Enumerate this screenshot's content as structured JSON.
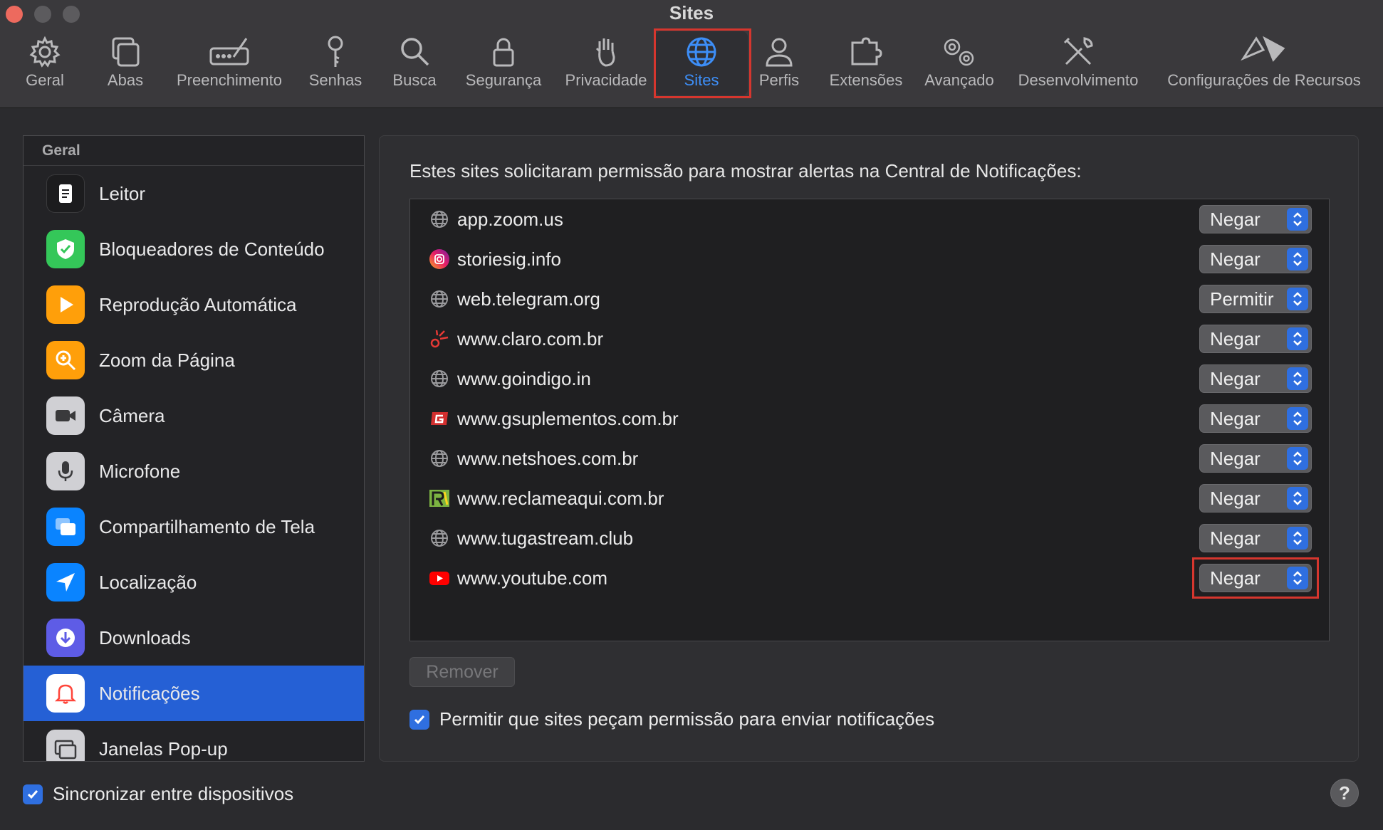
{
  "window": {
    "title": "Sites"
  },
  "toolbar": {
    "tabs": [
      {
        "label": "Geral",
        "icon": "gear-icon"
      },
      {
        "label": "Abas",
        "icon": "tabs-icon"
      },
      {
        "label": "Preenchimento",
        "icon": "autofill-icon"
      },
      {
        "label": "Senhas",
        "icon": "key-icon"
      },
      {
        "label": "Busca",
        "icon": "search-icon"
      },
      {
        "label": "Segurança",
        "icon": "lock-icon"
      },
      {
        "label": "Privacidade",
        "icon": "hand-icon"
      },
      {
        "label": "Sites",
        "icon": "globe-icon",
        "active": true
      },
      {
        "label": "Perfis",
        "icon": "person-icon"
      },
      {
        "label": "Extensões",
        "icon": "puzzle-icon"
      },
      {
        "label": "Avançado",
        "icon": "gears-icon"
      },
      {
        "label": "Desenvolvimento",
        "icon": "tools-icon"
      },
      {
        "label": "Configurações de Recursos",
        "icon": "flags-icon"
      }
    ]
  },
  "sidebar": {
    "header": "Geral",
    "items": [
      {
        "label": "Leitor",
        "icon": "reader-icon",
        "color": "#1c1c1e"
      },
      {
        "label": "Bloqueadores de Conteúdo",
        "icon": "shield-check-icon",
        "color": "#34c759"
      },
      {
        "label": "Reprodução Automática",
        "icon": "play-icon",
        "color": "#ff9f0a"
      },
      {
        "label": "Zoom da Página",
        "icon": "zoom-icon",
        "color": "#ff9f0a"
      },
      {
        "label": "Câmera",
        "icon": "camera-icon",
        "color": "#8e8e93"
      },
      {
        "label": "Microfone",
        "icon": "microphone-icon",
        "color": "#8e8e93"
      },
      {
        "label": "Compartilhamento de Tela",
        "icon": "screen-share-icon",
        "color": "#0a84ff"
      },
      {
        "label": "Localização",
        "icon": "location-icon",
        "color": "#0a84ff"
      },
      {
        "label": "Downloads",
        "icon": "download-icon",
        "color": "#5e5ce6"
      },
      {
        "label": "Notificações",
        "icon": "bell-icon",
        "color": "#ff453a",
        "selected": true
      },
      {
        "label": "Janelas Pop-up",
        "icon": "popup-window-icon",
        "color": "#8e8e93"
      }
    ]
  },
  "main": {
    "description": "Estes sites solicitaram permissão para mostrar alertas na Central de Notificações:",
    "sites": [
      {
        "name": "app.zoom.us",
        "favicon": "globe-icon",
        "permission": "Negar"
      },
      {
        "name": "storiesig.info",
        "favicon": "storiesig-icon",
        "permission": "Negar"
      },
      {
        "name": "web.telegram.org",
        "favicon": "globe-icon",
        "permission": "Permitir"
      },
      {
        "name": "www.claro.com.br",
        "favicon": "claro-icon",
        "permission": "Negar"
      },
      {
        "name": "www.goindigo.in",
        "favicon": "globe-icon",
        "permission": "Negar"
      },
      {
        "name": "www.gsuplementos.com.br",
        "favicon": "gsuplementos-icon",
        "permission": "Negar"
      },
      {
        "name": "www.netshoes.com.br",
        "favicon": "globe-icon",
        "permission": "Negar"
      },
      {
        "name": "www.reclameaqui.com.br",
        "favicon": "reclameaqui-icon",
        "permission": "Negar"
      },
      {
        "name": "www.tugastream.club",
        "favicon": "globe-icon",
        "permission": "Negar"
      },
      {
        "name": "www.youtube.com",
        "favicon": "youtube-icon",
        "permission": "Negar"
      }
    ],
    "remove_label": "Remover",
    "allow_requests_label": "Permitir que sites peçam permissão para enviar notificações",
    "allow_requests_checked": true
  },
  "footer": {
    "sync_label": "Sincronizar entre dispositivos",
    "sync_checked": true,
    "help_label": "?"
  },
  "colors": {
    "accent": "#3d8ef7",
    "selection": "#2560d5",
    "annotation_red": "#d6362e"
  }
}
